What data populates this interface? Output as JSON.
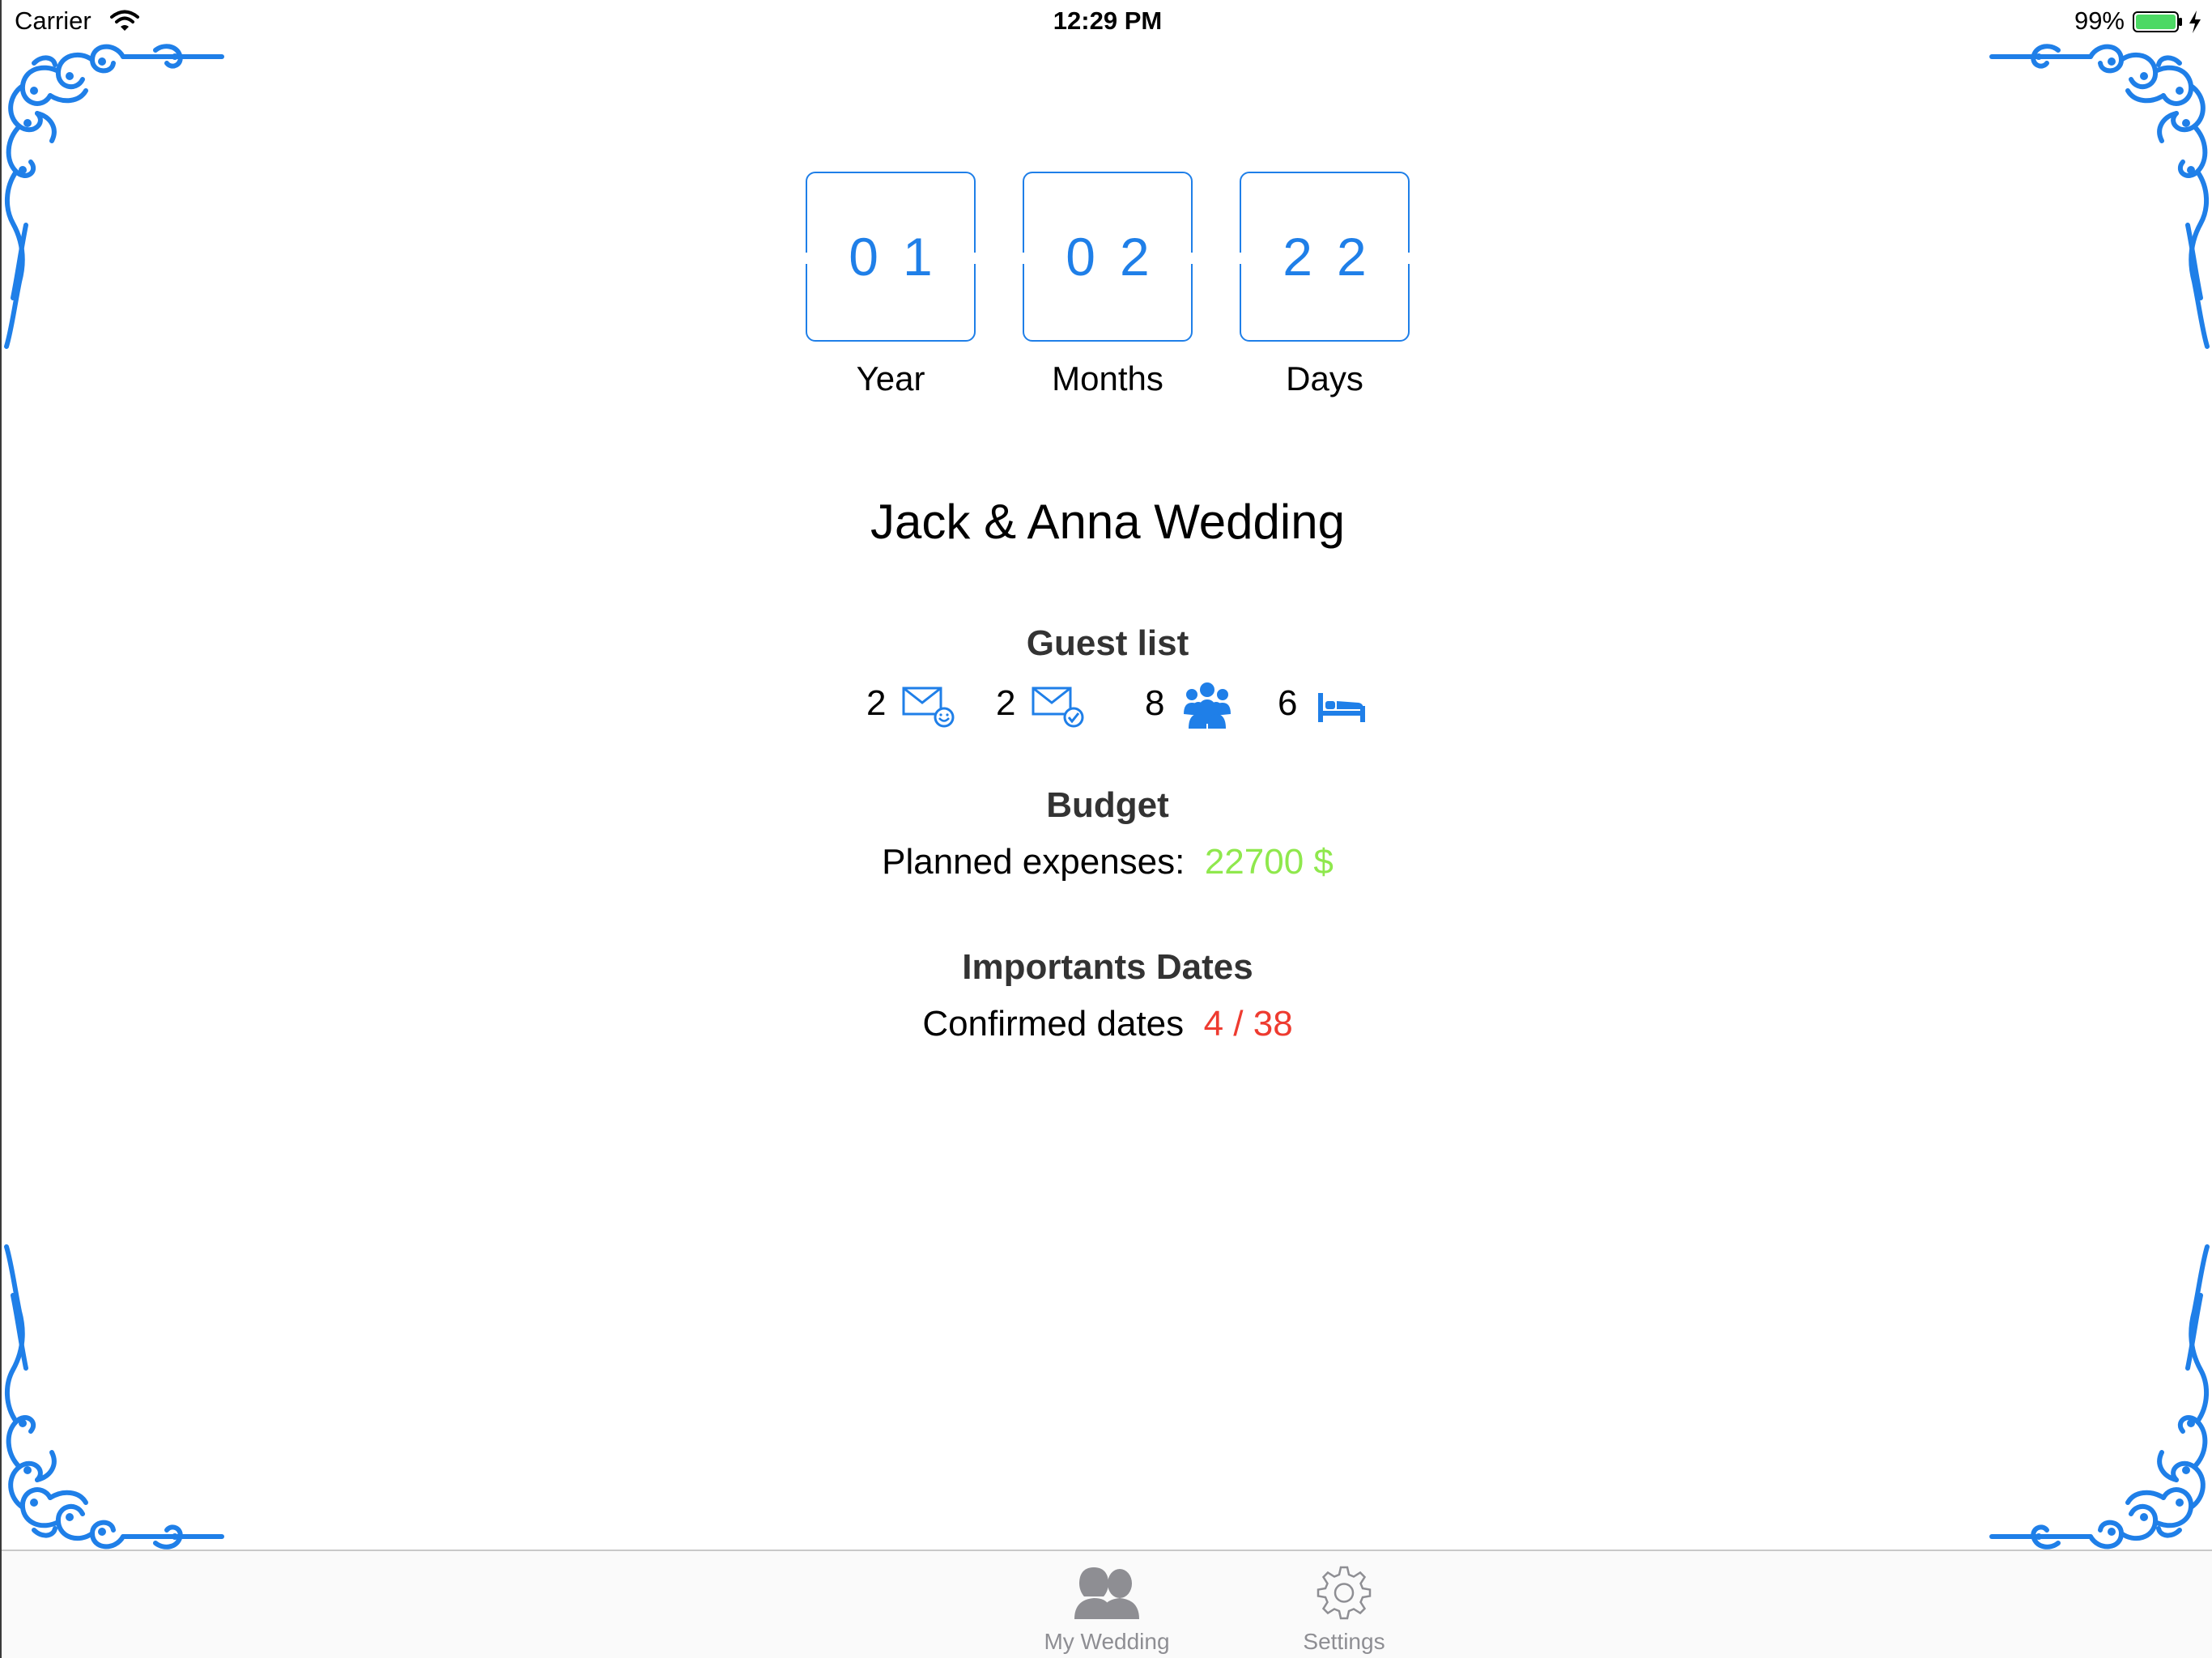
{
  "status_bar": {
    "carrier": "Carrier",
    "time": "12:29 PM",
    "battery": "99%"
  },
  "countdown": [
    {
      "value": "01",
      "label": "Year"
    },
    {
      "value": "02",
      "label": "Months"
    },
    {
      "value": "22",
      "label": "Days"
    }
  ],
  "title": "Jack & Anna Wedding",
  "guest_list": {
    "heading": "Guest list",
    "items": [
      {
        "count": "2",
        "icon": "envelope-smile-icon"
      },
      {
        "count": "2",
        "icon": "envelope-check-icon"
      },
      {
        "count": "8",
        "icon": "group-icon"
      },
      {
        "count": "6",
        "icon": "bed-icon"
      }
    ]
  },
  "budget": {
    "heading": "Budget",
    "label": "Planned expenses:",
    "value": "22700 $"
  },
  "dates": {
    "heading": "Importants Dates",
    "label": "Confirmed dates",
    "value": "4 / 38"
  },
  "tabs": [
    {
      "label": "My Wedding",
      "icon": "couple-icon",
      "active": true
    },
    {
      "label": "Settings",
      "icon": "gear-icon",
      "active": false
    }
  ],
  "colors": {
    "accent": "#1f7fe8",
    "budget_value": "#8fe84d",
    "dates_value": "#ee3b30",
    "tab_inactive": "#8e8e93"
  }
}
